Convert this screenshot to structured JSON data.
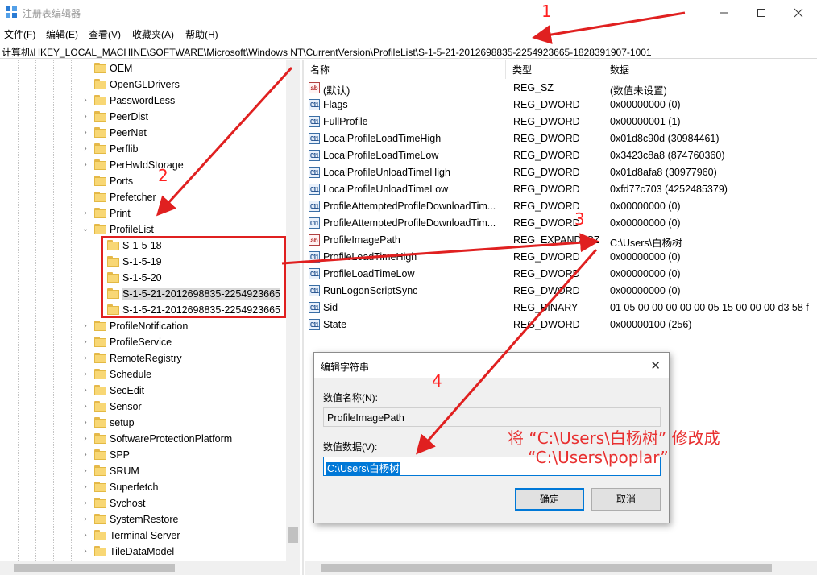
{
  "window": {
    "title": "注册表编辑器",
    "minimize_icon": "minimize-icon",
    "maximize_icon": "maximize-icon",
    "close_icon": "close-icon"
  },
  "menu": [
    "文件(F)",
    "编辑(E)",
    "查看(V)",
    "收藏夹(A)",
    "帮助(H)"
  ],
  "address": "计算机\\HKEY_LOCAL_MACHINE\\SOFTWARE\\Microsoft\\Windows NT\\CurrentVersion\\ProfileList\\S-1-5-21-2012698835-2254923665-1828391907-1001",
  "tree": {
    "items": [
      {
        "label": "OEM",
        "indent": 0,
        "expand": "",
        "selected": false
      },
      {
        "label": "OpenGLDrivers",
        "indent": 0,
        "expand": "",
        "selected": false
      },
      {
        "label": "PasswordLess",
        "indent": 0,
        "expand": "›",
        "selected": false
      },
      {
        "label": "PeerDist",
        "indent": 0,
        "expand": "›",
        "selected": false
      },
      {
        "label": "PeerNet",
        "indent": 0,
        "expand": "›",
        "selected": false
      },
      {
        "label": "Perflib",
        "indent": 0,
        "expand": "›",
        "selected": false
      },
      {
        "label": "PerHwIdStorage",
        "indent": 0,
        "expand": "›",
        "selected": false
      },
      {
        "label": "Ports",
        "indent": 0,
        "expand": "",
        "selected": false
      },
      {
        "label": "Prefetcher",
        "indent": 0,
        "expand": "",
        "selected": false
      },
      {
        "label": "Print",
        "indent": 0,
        "expand": "›",
        "selected": false
      },
      {
        "label": "ProfileList",
        "indent": 0,
        "expand": "⌄",
        "selected": false
      },
      {
        "label": "S-1-5-18",
        "indent": 1,
        "expand": "",
        "selected": false
      },
      {
        "label": "S-1-5-19",
        "indent": 1,
        "expand": "",
        "selected": false
      },
      {
        "label": "S-1-5-20",
        "indent": 1,
        "expand": "",
        "selected": false
      },
      {
        "label": "S-1-5-21-2012698835-2254923665",
        "indent": 1,
        "expand": "",
        "selected": true
      },
      {
        "label": "S-1-5-21-2012698835-2254923665",
        "indent": 1,
        "expand": "",
        "selected": false
      },
      {
        "label": "ProfileNotification",
        "indent": 0,
        "expand": "›",
        "selected": false
      },
      {
        "label": "ProfileService",
        "indent": 0,
        "expand": "›",
        "selected": false
      },
      {
        "label": "RemoteRegistry",
        "indent": 0,
        "expand": "›",
        "selected": false
      },
      {
        "label": "Schedule",
        "indent": 0,
        "expand": "›",
        "selected": false
      },
      {
        "label": "SecEdit",
        "indent": 0,
        "expand": "›",
        "selected": false
      },
      {
        "label": "Sensor",
        "indent": 0,
        "expand": "›",
        "selected": false
      },
      {
        "label": "setup",
        "indent": 0,
        "expand": "›",
        "selected": false
      },
      {
        "label": "SoftwareProtectionPlatform",
        "indent": 0,
        "expand": "›",
        "selected": false
      },
      {
        "label": "SPP",
        "indent": 0,
        "expand": "›",
        "selected": false
      },
      {
        "label": "SRUM",
        "indent": 0,
        "expand": "›",
        "selected": false
      },
      {
        "label": "Superfetch",
        "indent": 0,
        "expand": "›",
        "selected": false
      },
      {
        "label": "Svchost",
        "indent": 0,
        "expand": "›",
        "selected": false
      },
      {
        "label": "SystemRestore",
        "indent": 0,
        "expand": "›",
        "selected": false
      },
      {
        "label": "Terminal Server",
        "indent": 0,
        "expand": "›",
        "selected": false
      },
      {
        "label": "TileDataModel",
        "indent": 0,
        "expand": "›",
        "selected": false
      }
    ]
  },
  "list": {
    "headers": [
      "名称",
      "类型",
      "数据"
    ],
    "rows": [
      {
        "icon": "ab",
        "name": "(默认)",
        "type": "REG_SZ",
        "data": "(数值未设置)"
      },
      {
        "icon": "bin",
        "name": "Flags",
        "type": "REG_DWORD",
        "data": "0x00000000 (0)"
      },
      {
        "icon": "bin",
        "name": "FullProfile",
        "type": "REG_DWORD",
        "data": "0x00000001 (1)"
      },
      {
        "icon": "bin",
        "name": "LocalProfileLoadTimeHigh",
        "type": "REG_DWORD",
        "data": "0x01d8c90d (30984461)"
      },
      {
        "icon": "bin",
        "name": "LocalProfileLoadTimeLow",
        "type": "REG_DWORD",
        "data": "0x3423c8a8 (874760360)"
      },
      {
        "icon": "bin",
        "name": "LocalProfileUnloadTimeHigh",
        "type": "REG_DWORD",
        "data": "0x01d8afa8 (30977960)"
      },
      {
        "icon": "bin",
        "name": "LocalProfileUnloadTimeLow",
        "type": "REG_DWORD",
        "data": "0xfd77c703 (4252485379)"
      },
      {
        "icon": "bin",
        "name": "ProfileAttemptedProfileDownloadTim...",
        "type": "REG_DWORD",
        "data": "0x00000000 (0)"
      },
      {
        "icon": "bin",
        "name": "ProfileAttemptedProfileDownloadTim...",
        "type": "REG_DWORD",
        "data": "0x00000000 (0)"
      },
      {
        "icon": "ab",
        "name": "ProfileImagePath",
        "type": "REG_EXPAND_SZ",
        "data": "C:\\Users\\白杨树"
      },
      {
        "icon": "bin",
        "name": "ProfileLoadTimeHigh",
        "type": "REG_DWORD",
        "data": "0x00000000 (0)"
      },
      {
        "icon": "bin",
        "name": "ProfileLoadTimeLow",
        "type": "REG_DWORD",
        "data": "0x00000000 (0)"
      },
      {
        "icon": "bin",
        "name": "RunLogonScriptSync",
        "type": "REG_DWORD",
        "data": "0x00000000 (0)"
      },
      {
        "icon": "bin",
        "name": "Sid",
        "type": "REG_BINARY",
        "data": "01 05 00 00 00 00 00 05 15 00 00 00 d3 58 f"
      },
      {
        "icon": "bin",
        "name": "State",
        "type": "REG_DWORD",
        "data": "0x00000100 (256)"
      }
    ]
  },
  "dialog": {
    "title": "编辑字符串",
    "name_label": "数值名称(N):",
    "name_value": "ProfileImagePath",
    "data_label": "数值数据(V):",
    "data_value": "C:\\Users\\白杨树",
    "ok": "确定",
    "cancel": "取消"
  },
  "annotations": {
    "step1": "1",
    "step2": "2",
    "step3": "3",
    "step4": "4",
    "note_line1": "将 “C:\\Users\\白杨树” 修改成",
    "note_line2": "“C:\\Users\\poplar”",
    "color": "#ff2020"
  }
}
